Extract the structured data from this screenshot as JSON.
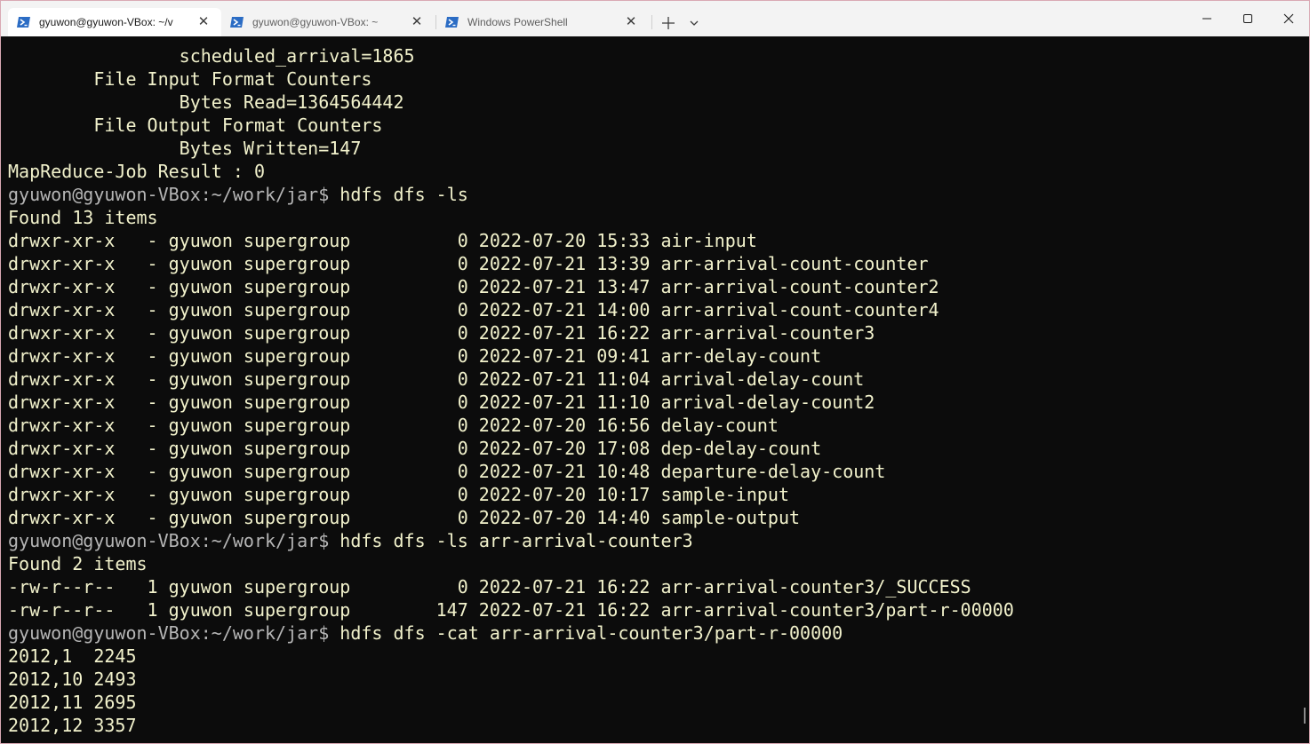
{
  "tabs": [
    {
      "title": "gyuwon@gyuwon-VBox: ~/v",
      "active": true
    },
    {
      "title": "gyuwon@gyuwon-VBox: ~",
      "active": false
    },
    {
      "title": "Windows PowerShell",
      "active": false
    }
  ],
  "toolbar": {
    "new_tab_icon": "plus-icon",
    "dropdown_icon": "chevron-down-icon"
  },
  "caption": {
    "minimize_icon": "minimize-icon",
    "maximize_icon": "maximize-icon",
    "close_icon": "close-icon"
  },
  "colors": {
    "terminal_bg": "#0c0c0c",
    "output_text": "#f2f2cc",
    "prompt_text": "#b6b6b6",
    "titlebar_bg": "#f3f3f3",
    "powershell_icon": "#2b6cc4"
  },
  "prompt": {
    "user": "gyuwon@gyuwon-VBox",
    "path": ":~/work/jar$ "
  },
  "terminal": {
    "lines": [
      {
        "type": "output",
        "text": "                scheduled_arrival=1865"
      },
      {
        "type": "output",
        "text": "        File Input Format Counters"
      },
      {
        "type": "output",
        "text": "                Bytes Read=1364564442"
      },
      {
        "type": "output",
        "text": "        File Output Format Counters"
      },
      {
        "type": "output",
        "text": "                Bytes Written=147"
      },
      {
        "type": "output",
        "text": "MapReduce-Job Result : 0"
      },
      {
        "type": "prompt",
        "text": "hdfs dfs -ls"
      },
      {
        "type": "output",
        "text": "Found 13 items"
      },
      {
        "type": "output",
        "text": "drwxr-xr-x   - gyuwon supergroup          0 2022-07-20 15:33 air-input"
      },
      {
        "type": "output",
        "text": "drwxr-xr-x   - gyuwon supergroup          0 2022-07-21 13:39 arr-arrival-count-counter"
      },
      {
        "type": "output",
        "text": "drwxr-xr-x   - gyuwon supergroup          0 2022-07-21 13:47 arr-arrival-count-counter2"
      },
      {
        "type": "output",
        "text": "drwxr-xr-x   - gyuwon supergroup          0 2022-07-21 14:00 arr-arrival-count-counter4"
      },
      {
        "type": "output",
        "text": "drwxr-xr-x   - gyuwon supergroup          0 2022-07-21 16:22 arr-arrival-counter3"
      },
      {
        "type": "output",
        "text": "drwxr-xr-x   - gyuwon supergroup          0 2022-07-21 09:41 arr-delay-count"
      },
      {
        "type": "output",
        "text": "drwxr-xr-x   - gyuwon supergroup          0 2022-07-21 11:04 arrival-delay-count"
      },
      {
        "type": "output",
        "text": "drwxr-xr-x   - gyuwon supergroup          0 2022-07-21 11:10 arrival-delay-count2"
      },
      {
        "type": "output",
        "text": "drwxr-xr-x   - gyuwon supergroup          0 2022-07-20 16:56 delay-count"
      },
      {
        "type": "output",
        "text": "drwxr-xr-x   - gyuwon supergroup          0 2022-07-20 17:08 dep-delay-count"
      },
      {
        "type": "output",
        "text": "drwxr-xr-x   - gyuwon supergroup          0 2022-07-21 10:48 departure-delay-count"
      },
      {
        "type": "output",
        "text": "drwxr-xr-x   - gyuwon supergroup          0 2022-07-20 10:17 sample-input"
      },
      {
        "type": "output",
        "text": "drwxr-xr-x   - gyuwon supergroup          0 2022-07-20 14:40 sample-output"
      },
      {
        "type": "prompt",
        "text": "hdfs dfs -ls arr-arrival-counter3"
      },
      {
        "type": "output",
        "text": "Found 2 items"
      },
      {
        "type": "output",
        "text": "-rw-r--r--   1 gyuwon supergroup          0 2022-07-21 16:22 arr-arrival-counter3/_SUCCESS"
      },
      {
        "type": "output",
        "text": "-rw-r--r--   1 gyuwon supergroup        147 2022-07-21 16:22 arr-arrival-counter3/part-r-00000"
      },
      {
        "type": "prompt",
        "text": "hdfs dfs -cat arr-arrival-counter3/part-r-00000"
      },
      {
        "type": "output",
        "text": "2012,1  2245"
      },
      {
        "type": "output",
        "text": "2012,10 2493"
      },
      {
        "type": "output",
        "text": "2012,11 2695"
      },
      {
        "type": "output",
        "text": "2012,12 3357"
      }
    ]
  }
}
